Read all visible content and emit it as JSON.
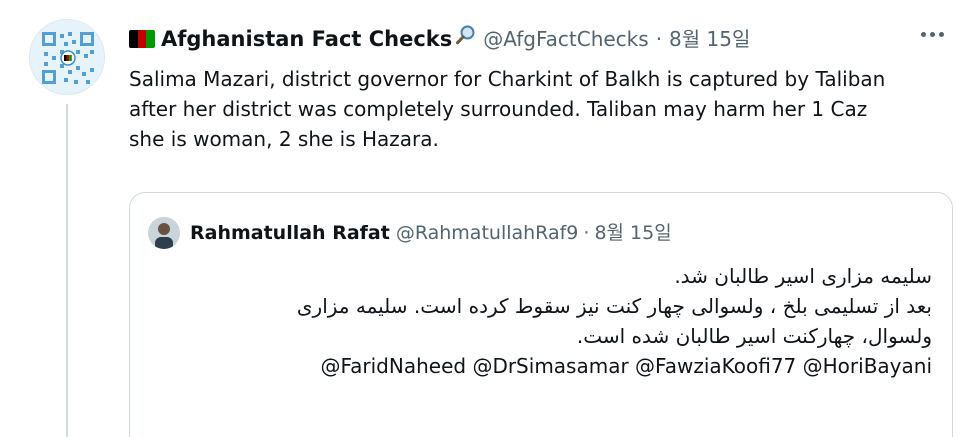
{
  "tweet": {
    "display_name": "Afghanistan Fact Checks",
    "handle": "@AfgFactChecks",
    "separator": "·",
    "date": "8월 15일",
    "text_lines": [
      "Salima Mazari, district governor for Charkint of Balkh is captured by Taliban",
      "after her district was completely surrounded. Taliban may  harm her 1 Caz",
      "she is woman, 2 she is Hazara."
    ],
    "icons": [
      "flag-afghanistan-icon",
      "magnifier-icon",
      "more-icon"
    ]
  },
  "quoted_tweet": {
    "display_name": "Rahmatullah Rafat",
    "handle": "@RahmatullahRaf9",
    "separator": "·",
    "date": "8월 15일",
    "rtl_lines": [
      "سلیمه مزاری اسیر طالبان شد.",
      "بعد از تسلیمی بلخ ، ولسوالی چهار کنت نیز سقوط کرده است. سلیمه مزاری",
      "ولسوال، چهارکنت اسیر طالبان شده است."
    ],
    "mentions": [
      "@FaridNaheed",
      "@DrSimasamar",
      "@FawziaKoofi77",
      "@HoriBayani"
    ]
  },
  "colors": {
    "text": "#0f1419",
    "secondary": "#536471",
    "border": "#cfd9de",
    "flag_black": "#000000",
    "flag_red": "#be0000",
    "flag_green": "#009900"
  }
}
